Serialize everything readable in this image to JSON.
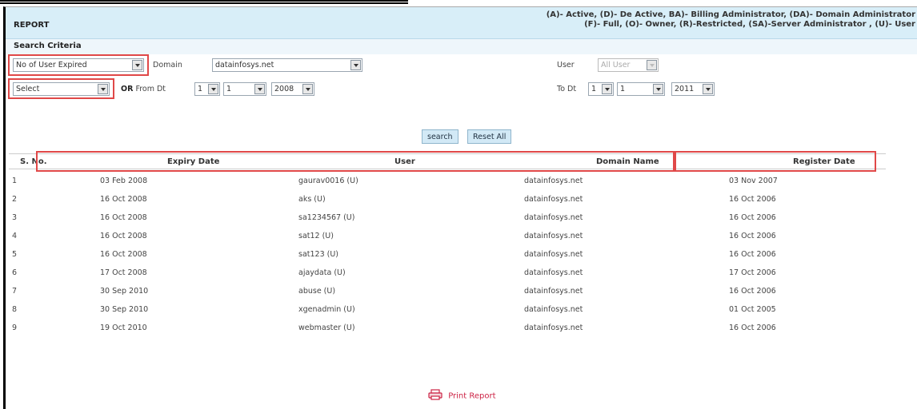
{
  "header": {
    "title": "REPORT",
    "legend_line1": "(A)- Active, (D)- De Active, BA)- Billing Administrator, (DA)- Domain Administrator",
    "legend_line2": "(F)- Full, (O)- Owner, (R)-Restricted, (SA)-Server Administrator , (U)- User"
  },
  "criteria": {
    "title": "Search Criteria",
    "report_type": "No of User Expired",
    "domain_label": "Domain",
    "domain_value": "datainfosys.net",
    "user_label": "User",
    "user_value": "All User",
    "period_value": "Select",
    "or_label": "OR",
    "from_label": "From Dt",
    "from_day": "1",
    "from_month": "1",
    "from_year": "2008",
    "to_label": "To Dt",
    "to_day": "1",
    "to_month": "1",
    "to_year": "2011"
  },
  "buttons": {
    "search": "search",
    "reset": "Reset All"
  },
  "table": {
    "columns": [
      "S. No.",
      "Expiry Date",
      "User",
      "Domain Name",
      "Register Date"
    ],
    "rows": [
      {
        "sno": "1",
        "expiry": "03 Feb 2008",
        "user": "gaurav0016 (U)",
        "domain": "datainfosys.net",
        "register": "03 Nov 2007"
      },
      {
        "sno": "2",
        "expiry": "16 Oct 2008",
        "user": "aks (U)",
        "domain": "datainfosys.net",
        "register": "16 Oct 2006"
      },
      {
        "sno": "3",
        "expiry": "16 Oct 2008",
        "user": "sa1234567 (U)",
        "domain": "datainfosys.net",
        "register": "16 Oct 2006"
      },
      {
        "sno": "4",
        "expiry": "16 Oct 2008",
        "user": "sat12 (U)",
        "domain": "datainfosys.net",
        "register": "16 Oct 2006"
      },
      {
        "sno": "5",
        "expiry": "16 Oct 2008",
        "user": "sat123 (U)",
        "domain": "datainfosys.net",
        "register": "16 Oct 2006"
      },
      {
        "sno": "6",
        "expiry": "17 Oct 2008",
        "user": "ajaydata (U)",
        "domain": "datainfosys.net",
        "register": "17 Oct 2006"
      },
      {
        "sno": "7",
        "expiry": "30 Sep 2010",
        "user": "abuse (U)",
        "domain": "datainfosys.net",
        "register": "16 Oct 2006"
      },
      {
        "sno": "8",
        "expiry": "30 Sep 2010",
        "user": "xgenadmin (U)",
        "domain": "datainfosys.net",
        "register": "01 Oct 2005"
      },
      {
        "sno": "9",
        "expiry": "19 Oct 2010",
        "user": "webmaster (U)",
        "domain": "datainfosys.net",
        "register": "16 Oct 2006"
      }
    ]
  },
  "footer": {
    "print_label": "Print Report",
    "print_icon": "printer-icon"
  },
  "colors": {
    "header_bg": "#d8eef8",
    "highlight_red": "#e04848",
    "button_bg": "#d2e9f6",
    "print_link": "#cc2244"
  }
}
